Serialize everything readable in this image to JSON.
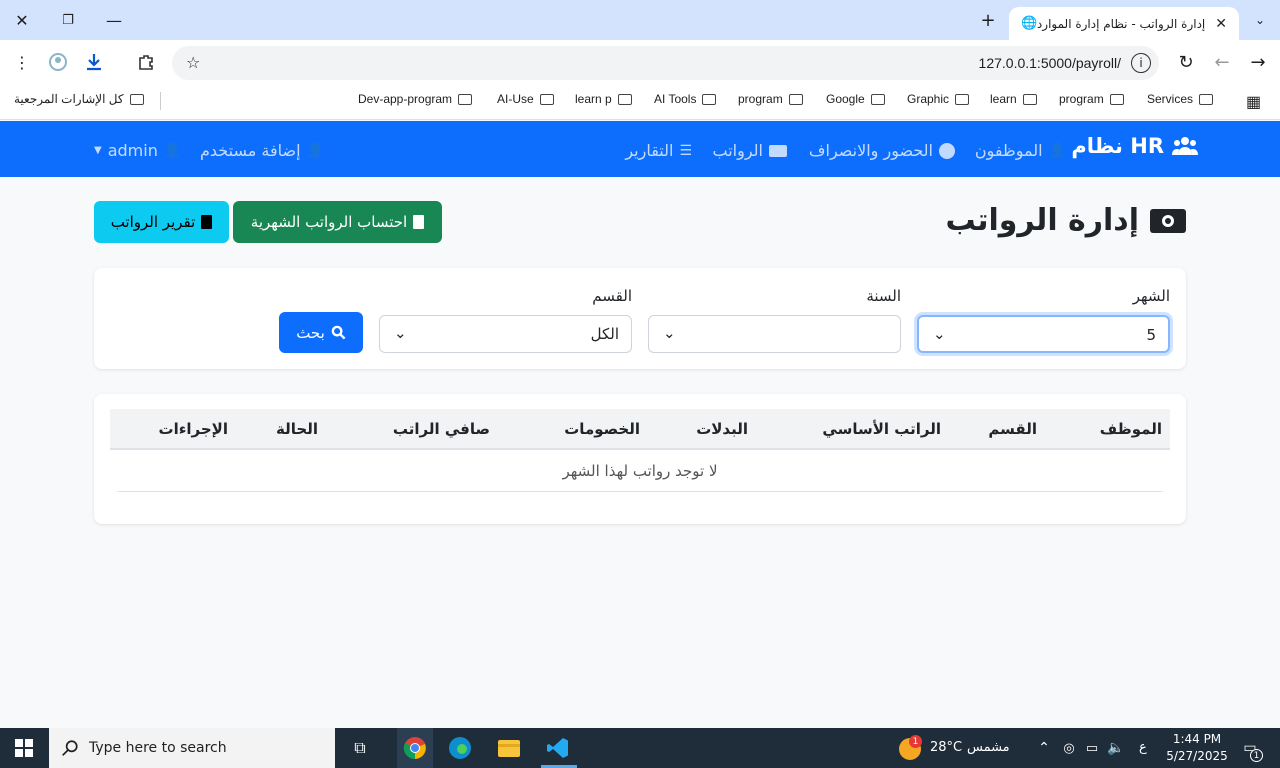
{
  "browser": {
    "tab_title": "إدارة الرواتب - نظام إدارة الموارد ا",
    "url": "127.0.0.1:5000/payroll/",
    "bookmarks": [
      "Services",
      "program",
      "learn",
      "Graphic",
      "Google",
      "program",
      "AI Tools",
      "learn p",
      "AI-Use",
      "Dev-app-program"
    ],
    "all_bookmarks": "كل الإشارات المرجعية"
  },
  "navbar": {
    "brand": "نظام HR",
    "items": [
      "الموظفون",
      "الحضور والانصراف",
      "الرواتب",
      "التقارير"
    ],
    "add_user": "إضافة مستخدم",
    "user": "admin"
  },
  "page": {
    "title": "إدارة الرواتب",
    "calc_button": "احتساب الرواتب الشهرية",
    "report_button": "تقرير الرواتب"
  },
  "filters": {
    "month_label": "الشهر",
    "month_value": "5",
    "year_label": "السنة",
    "year_value": "",
    "dept_label": "القسم",
    "dept_value": "الكل",
    "search_button": "بحث"
  },
  "table": {
    "headers": [
      "الموظف",
      "القسم",
      "الراتب الأساسي",
      "البدلات",
      "الخصومات",
      "صافي الراتب",
      "الحالة",
      "الإجراءات"
    ],
    "empty_message": "لا توجد رواتب لهذا الشهر"
  },
  "taskbar": {
    "search_placeholder": "Type here to search",
    "weather_temp": "28°C",
    "weather_text": "مشمس",
    "lang": "ع",
    "time": "1:44 PM",
    "date": "5/27/2025",
    "notification_count": "1",
    "weather_badge": "1"
  },
  "colors": {
    "primary": "#0d6efd",
    "success": "#198754",
    "info": "#0dcaf0"
  }
}
